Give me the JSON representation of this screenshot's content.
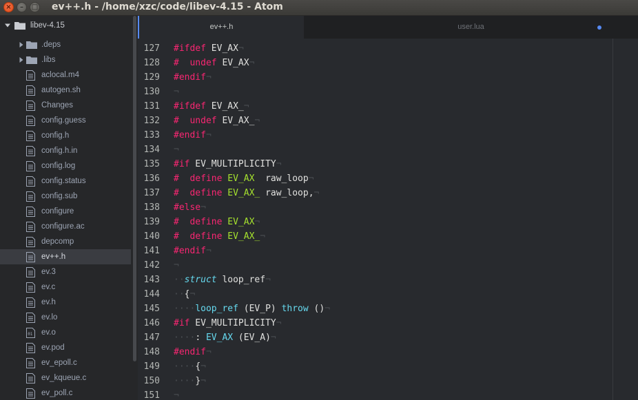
{
  "window": {
    "title": "ev++.h - /home/xzc/code/libev-4.15 - Atom",
    "close_glyph": "×",
    "min_glyph": "–",
    "max_glyph": "□"
  },
  "tree": {
    "root": "libev-4.15",
    "items": [
      {
        "label": ".deps",
        "kind": "folder"
      },
      {
        "label": ".libs",
        "kind": "folder"
      },
      {
        "label": "aclocal.m4",
        "kind": "file"
      },
      {
        "label": "autogen.sh",
        "kind": "file"
      },
      {
        "label": "Changes",
        "kind": "file"
      },
      {
        "label": "config.guess",
        "kind": "file"
      },
      {
        "label": "config.h",
        "kind": "file"
      },
      {
        "label": "config.h.in",
        "kind": "file"
      },
      {
        "label": "config.log",
        "kind": "file"
      },
      {
        "label": "config.status",
        "kind": "file"
      },
      {
        "label": "config.sub",
        "kind": "file"
      },
      {
        "label": "configure",
        "kind": "file"
      },
      {
        "label": "configure.ac",
        "kind": "file"
      },
      {
        "label": "depcomp",
        "kind": "file"
      },
      {
        "label": "ev++.h",
        "kind": "file",
        "selected": true
      },
      {
        "label": "ev.3",
        "kind": "file"
      },
      {
        "label": "ev.c",
        "kind": "file"
      },
      {
        "label": "ev.h",
        "kind": "file"
      },
      {
        "label": "ev.lo",
        "kind": "file"
      },
      {
        "label": "ev.o",
        "kind": "binary"
      },
      {
        "label": "ev.pod",
        "kind": "file"
      },
      {
        "label": "ev_epoll.c",
        "kind": "file"
      },
      {
        "label": "ev_kqueue.c",
        "kind": "file"
      },
      {
        "label": "ev_poll.c",
        "kind": "file"
      }
    ]
  },
  "tabs": [
    {
      "label": "ev++.h",
      "active": true
    },
    {
      "label": "user.lua",
      "active": false,
      "modified": true
    }
  ],
  "colors": {
    "directive": "#f92672",
    "defined_name": "#a6e22e",
    "keyword": "#66d9ef",
    "accent": "#568af2"
  },
  "editor": {
    "lines": [
      {
        "n": "127",
        "tokens": [
          [
            "t-dir",
            "#ifdef"
          ],
          [
            "t-mac",
            " EV_AX"
          ],
          [
            "t-inv",
            "¬"
          ]
        ]
      },
      {
        "n": "128",
        "tokens": [
          [
            "t-dir",
            "#"
          ],
          [
            "t-mac",
            "  "
          ],
          [
            "t-dir",
            "undef"
          ],
          [
            "t-mac",
            " EV_AX"
          ],
          [
            "t-inv",
            "¬"
          ]
        ]
      },
      {
        "n": "129",
        "tokens": [
          [
            "t-dir",
            "#endif"
          ],
          [
            "t-inv",
            "¬"
          ]
        ]
      },
      {
        "n": "130",
        "tokens": [
          [
            "t-inv",
            "¬"
          ]
        ]
      },
      {
        "n": "131",
        "tokens": [
          [
            "t-dir",
            "#ifdef"
          ],
          [
            "t-mac",
            " EV_AX_"
          ],
          [
            "t-inv",
            "¬"
          ]
        ]
      },
      {
        "n": "132",
        "tokens": [
          [
            "t-dir",
            "#"
          ],
          [
            "t-mac",
            "  "
          ],
          [
            "t-dir",
            "undef"
          ],
          [
            "t-mac",
            " EV_AX_"
          ],
          [
            "t-inv",
            "¬"
          ]
        ]
      },
      {
        "n": "133",
        "tokens": [
          [
            "t-dir",
            "#endif"
          ],
          [
            "t-inv",
            "¬"
          ]
        ]
      },
      {
        "n": "134",
        "tokens": [
          [
            "t-inv",
            "¬"
          ]
        ]
      },
      {
        "n": "135",
        "tokens": [
          [
            "t-dir",
            "#if"
          ],
          [
            "t-mac",
            " EV_MULTIPLICITY"
          ],
          [
            "t-inv",
            "¬"
          ]
        ]
      },
      {
        "n": "136",
        "tokens": [
          [
            "t-dir",
            "#"
          ],
          [
            "t-mac",
            "  "
          ],
          [
            "t-dir",
            "define"
          ],
          [
            "t-mac",
            " "
          ],
          [
            "t-def",
            "EV_AX"
          ],
          [
            "t-mac",
            "  raw_loop"
          ],
          [
            "t-inv",
            "¬"
          ]
        ]
      },
      {
        "n": "137",
        "tokens": [
          [
            "t-dir",
            "#"
          ],
          [
            "t-mac",
            "  "
          ],
          [
            "t-dir",
            "define"
          ],
          [
            "t-mac",
            " "
          ],
          [
            "t-def",
            "EV_AX_"
          ],
          [
            "t-mac",
            " raw_loop,"
          ],
          [
            "t-inv",
            "¬"
          ]
        ]
      },
      {
        "n": "138",
        "tokens": [
          [
            "t-dir",
            "#else"
          ],
          [
            "t-inv",
            "¬"
          ]
        ]
      },
      {
        "n": "139",
        "tokens": [
          [
            "t-dir",
            "#"
          ],
          [
            "t-mac",
            "  "
          ],
          [
            "t-dir",
            "define"
          ],
          [
            "t-mac",
            " "
          ],
          [
            "t-def",
            "EV_AX"
          ],
          [
            "t-inv",
            "¬"
          ]
        ]
      },
      {
        "n": "140",
        "tokens": [
          [
            "t-dir",
            "#"
          ],
          [
            "t-mac",
            "  "
          ],
          [
            "t-dir",
            "define"
          ],
          [
            "t-mac",
            " "
          ],
          [
            "t-def",
            "EV_AX_"
          ],
          [
            "t-inv",
            "¬"
          ]
        ]
      },
      {
        "n": "141",
        "tokens": [
          [
            "t-dir",
            "#endif"
          ],
          [
            "t-inv",
            "¬"
          ]
        ]
      },
      {
        "n": "142",
        "tokens": [
          [
            "t-inv",
            "¬"
          ]
        ]
      },
      {
        "n": "143",
        "tokens": [
          [
            "t-inv",
            "··"
          ],
          [
            "t-it",
            "struct"
          ],
          [
            "t-mac",
            " loop_ref"
          ],
          [
            "t-inv",
            "¬"
          ]
        ]
      },
      {
        "n": "144",
        "tokens": [
          [
            "t-inv",
            "··"
          ],
          [
            "t-mac",
            "{"
          ],
          [
            "t-inv",
            "¬"
          ]
        ]
      },
      {
        "n": "145",
        "tokens": [
          [
            "t-inv",
            "····"
          ],
          [
            "t-fn",
            "loop_ref"
          ],
          [
            "t-mac",
            " (EV_P) "
          ],
          [
            "t-kw",
            "throw"
          ],
          [
            "t-mac",
            " ()"
          ],
          [
            "t-inv",
            "¬"
          ]
        ]
      },
      {
        "n": "146",
        "tokens": [
          [
            "t-dir",
            "#if"
          ],
          [
            "t-mac",
            " EV_MULTIPLICITY"
          ],
          [
            "t-inv",
            "¬"
          ]
        ]
      },
      {
        "n": "147",
        "tokens": [
          [
            "t-inv",
            "····"
          ],
          [
            "t-mac",
            ": "
          ],
          [
            "t-fn",
            "EV_AX"
          ],
          [
            "t-mac",
            " (EV_A)"
          ],
          [
            "t-inv",
            "¬"
          ]
        ]
      },
      {
        "n": "148",
        "tokens": [
          [
            "t-dir",
            "#endif"
          ],
          [
            "t-inv",
            "¬"
          ]
        ]
      },
      {
        "n": "149",
        "tokens": [
          [
            "t-inv",
            "····"
          ],
          [
            "t-mac",
            "{"
          ],
          [
            "t-inv",
            "¬"
          ]
        ]
      },
      {
        "n": "150",
        "tokens": [
          [
            "t-inv",
            "····"
          ],
          [
            "t-mac",
            "}"
          ],
          [
            "t-inv",
            "¬"
          ]
        ]
      },
      {
        "n": "151",
        "tokens": [
          [
            "t-inv",
            "¬"
          ]
        ]
      }
    ]
  }
}
